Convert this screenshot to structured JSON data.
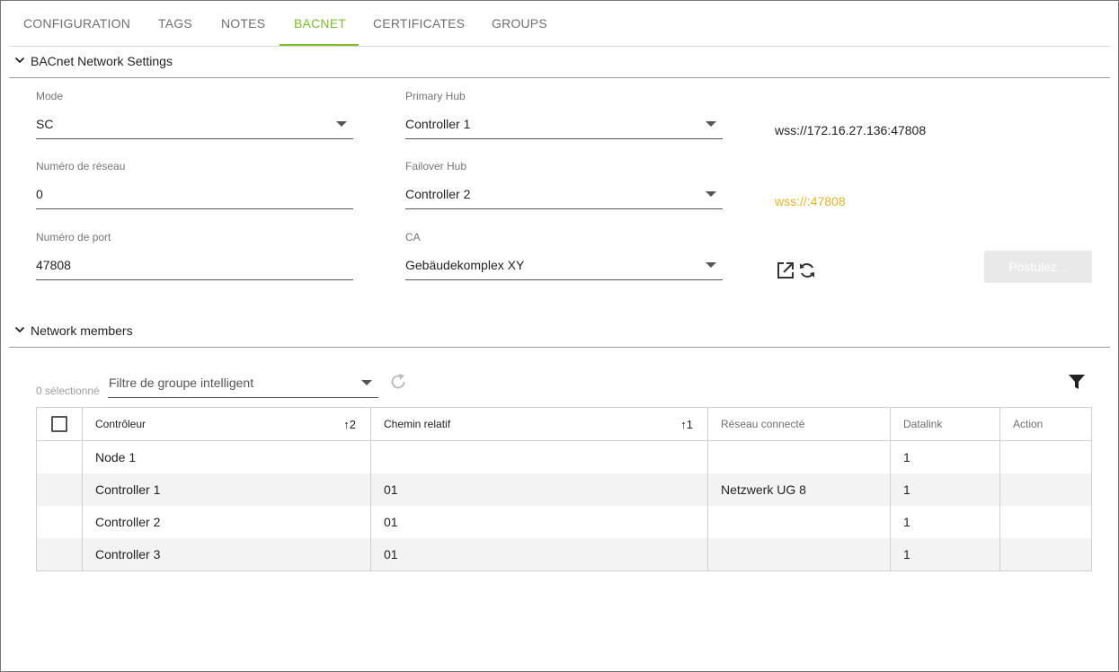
{
  "tabs": [
    {
      "label": "CONFIGURATION",
      "active": false
    },
    {
      "label": "TAGS",
      "active": false
    },
    {
      "label": "NOTES",
      "active": false
    },
    {
      "label": "BACNET",
      "active": true
    },
    {
      "label": "CERTIFICATES",
      "active": false
    },
    {
      "label": "GROUPS",
      "active": false
    }
  ],
  "network_settings": {
    "title": "BACnet Network Settings",
    "mode": {
      "label": "Mode",
      "value": "SC"
    },
    "network_number": {
      "label": "Numéro de réseau",
      "value": "0"
    },
    "port_number": {
      "label": "Numéro de port",
      "value": "47808"
    },
    "primary_hub": {
      "label": "Primary Hub",
      "value": "Controller 1",
      "url": "wss://172.16.27.136:47808"
    },
    "failover_hub": {
      "label": "Failover Hub",
      "value": "Controller 2",
      "url": "wss://:47808"
    },
    "ca": {
      "label": "CA",
      "value": "Gebäudekomplex XY"
    },
    "apply_button": "Postulez...",
    "failover_url_color": "#e6b422",
    "accent_color": "#7cbf2a"
  },
  "network_members": {
    "title": "Network members",
    "selected_count": "0 sélectionné",
    "group_filter": "Filtre de groupe intelligent",
    "columns": [
      {
        "label": "Contrôleur",
        "sort": "↑2"
      },
      {
        "label": "Chemin relatif",
        "sort": "↑1"
      },
      {
        "label": "Réseau connecté",
        "sort": ""
      },
      {
        "label": "Datalink",
        "sort": ""
      },
      {
        "label": "Action",
        "sort": ""
      }
    ],
    "rows": [
      [
        "Node 1",
        "",
        "",
        "1",
        ""
      ],
      [
        "Controller 1",
        "01",
        "Netzwerk UG 8",
        "1",
        ""
      ],
      [
        "Controller 2",
        "01",
        "",
        "1",
        ""
      ],
      [
        "Controller 3",
        "01",
        "",
        "1",
        ""
      ]
    ]
  },
  "icons": [
    "chevron-down-icon",
    "open-external-icon",
    "refresh-icon",
    "reload-icon",
    "filter-icon"
  ]
}
